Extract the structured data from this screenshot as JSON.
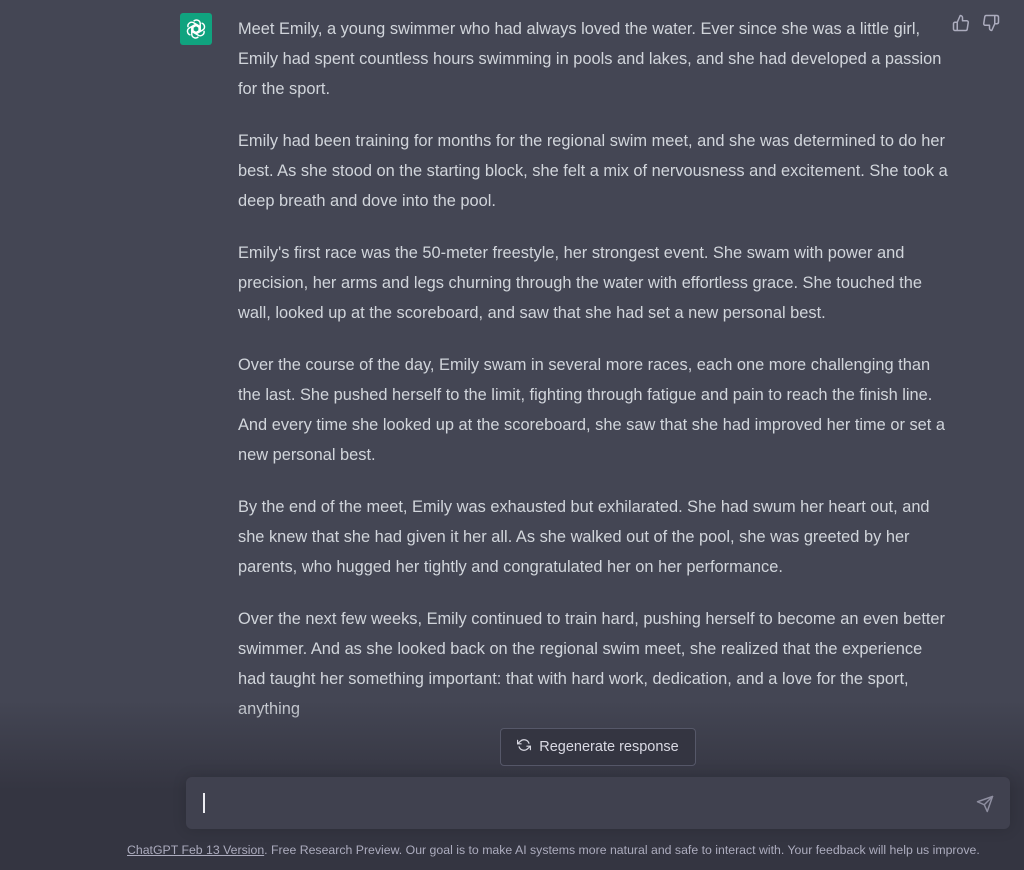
{
  "message": {
    "paragraphs": [
      "Meet Emily, a young swimmer who had always loved the water. Ever since she was a little girl, Emily had spent countless hours swimming in pools and lakes, and she had developed a passion for the sport.",
      "Emily had been training for months for the regional swim meet, and she was determined to do her best. As she stood on the starting block, she felt a mix of nervousness and excitement. She took a deep breath and dove into the pool.",
      "Emily's first race was the 50-meter freestyle, her strongest event. She swam with power and precision, her arms and legs churning through the water with effortless grace. She touched the wall, looked up at the scoreboard, and saw that she had set a new personal best.",
      "Over the course of the day, Emily swam in several more races, each one more challenging than the last. She pushed herself to the limit, fighting through fatigue and pain to reach the finish line. And every time she looked up at the scoreboard, she saw that she had improved her time or set a new personal best.",
      "By the end of the meet, Emily was exhausted but exhilarated. She had swum her heart out, and she knew that she had given it her all. As she walked out of the pool, she was greeted by her parents, who hugged her tightly and congratulated her on her performance.",
      "Over the next few weeks, Emily continued to train hard, pushing herself to become an even better swimmer. And as she looked back on the regional swim meet, she realized that the experience had taught her something important: that with hard work, dedication, and a love for the sport, anything"
    ]
  },
  "regenerate": {
    "label": "Regenerate response"
  },
  "footer": {
    "version_link": "ChatGPT Feb 13 Version",
    "text": ". Free Research Preview. Our goal is to make AI systems more natural and safe to interact with. Your feedback will help us improve."
  },
  "icons": {
    "avatar": "openai-logo-icon",
    "thumbs_up": "thumbs-up-icon",
    "thumbs_down": "thumbs-down-icon",
    "regenerate": "refresh-icon",
    "send": "send-icon"
  },
  "colors": {
    "background": "#343541",
    "message_background": "#444654",
    "accent": "#10a37f",
    "text": "#d1d5db",
    "input_background": "#40414f"
  }
}
